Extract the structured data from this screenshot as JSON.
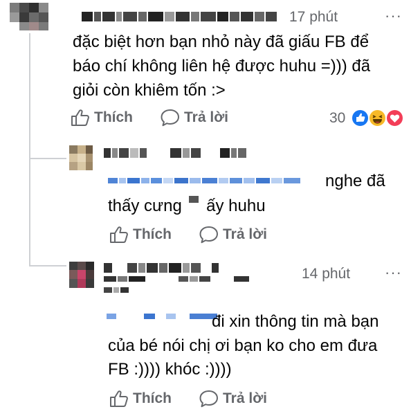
{
  "comments": [
    {
      "time": "17 phút",
      "more": "···",
      "text_lines": [
        "đặc biệt hơn bạn nhỏ này đã giấu FB để",
        "báo chí không liên hệ được huhu =))) đã",
        "giỏi còn khiêm tốn :>"
      ],
      "like_label": "Thích",
      "reply_label": "Trả lời",
      "reaction_count": "30"
    },
    {
      "text_line1_suffix": "nghe đã",
      "text_line2_a": "thấy cưng",
      "text_line2_b": "ấy huhu",
      "like_label": "Thích",
      "reply_label": "Trả lời"
    },
    {
      "time": "14 phút",
      "more": "···",
      "text_line1_suffix": "đi xin thông tin mà bạn",
      "text_lines": [
        "của bé nói chị ơi bạn ko cho em đưa",
        "FB :)))) khóc :))))"
      ],
      "like_label": "Thích",
      "reply_label": "Trả lời"
    }
  ],
  "colors": {
    "text": "#050505",
    "meta": "#65676b",
    "like": "#1877f2",
    "haha": "#f7b928",
    "love": "#f33e58"
  },
  "icons": [
    "thumb-up-icon",
    "speech-bubble-icon",
    "like-reaction-icon",
    "haha-reaction-icon",
    "love-reaction-icon",
    "more-icon"
  ]
}
